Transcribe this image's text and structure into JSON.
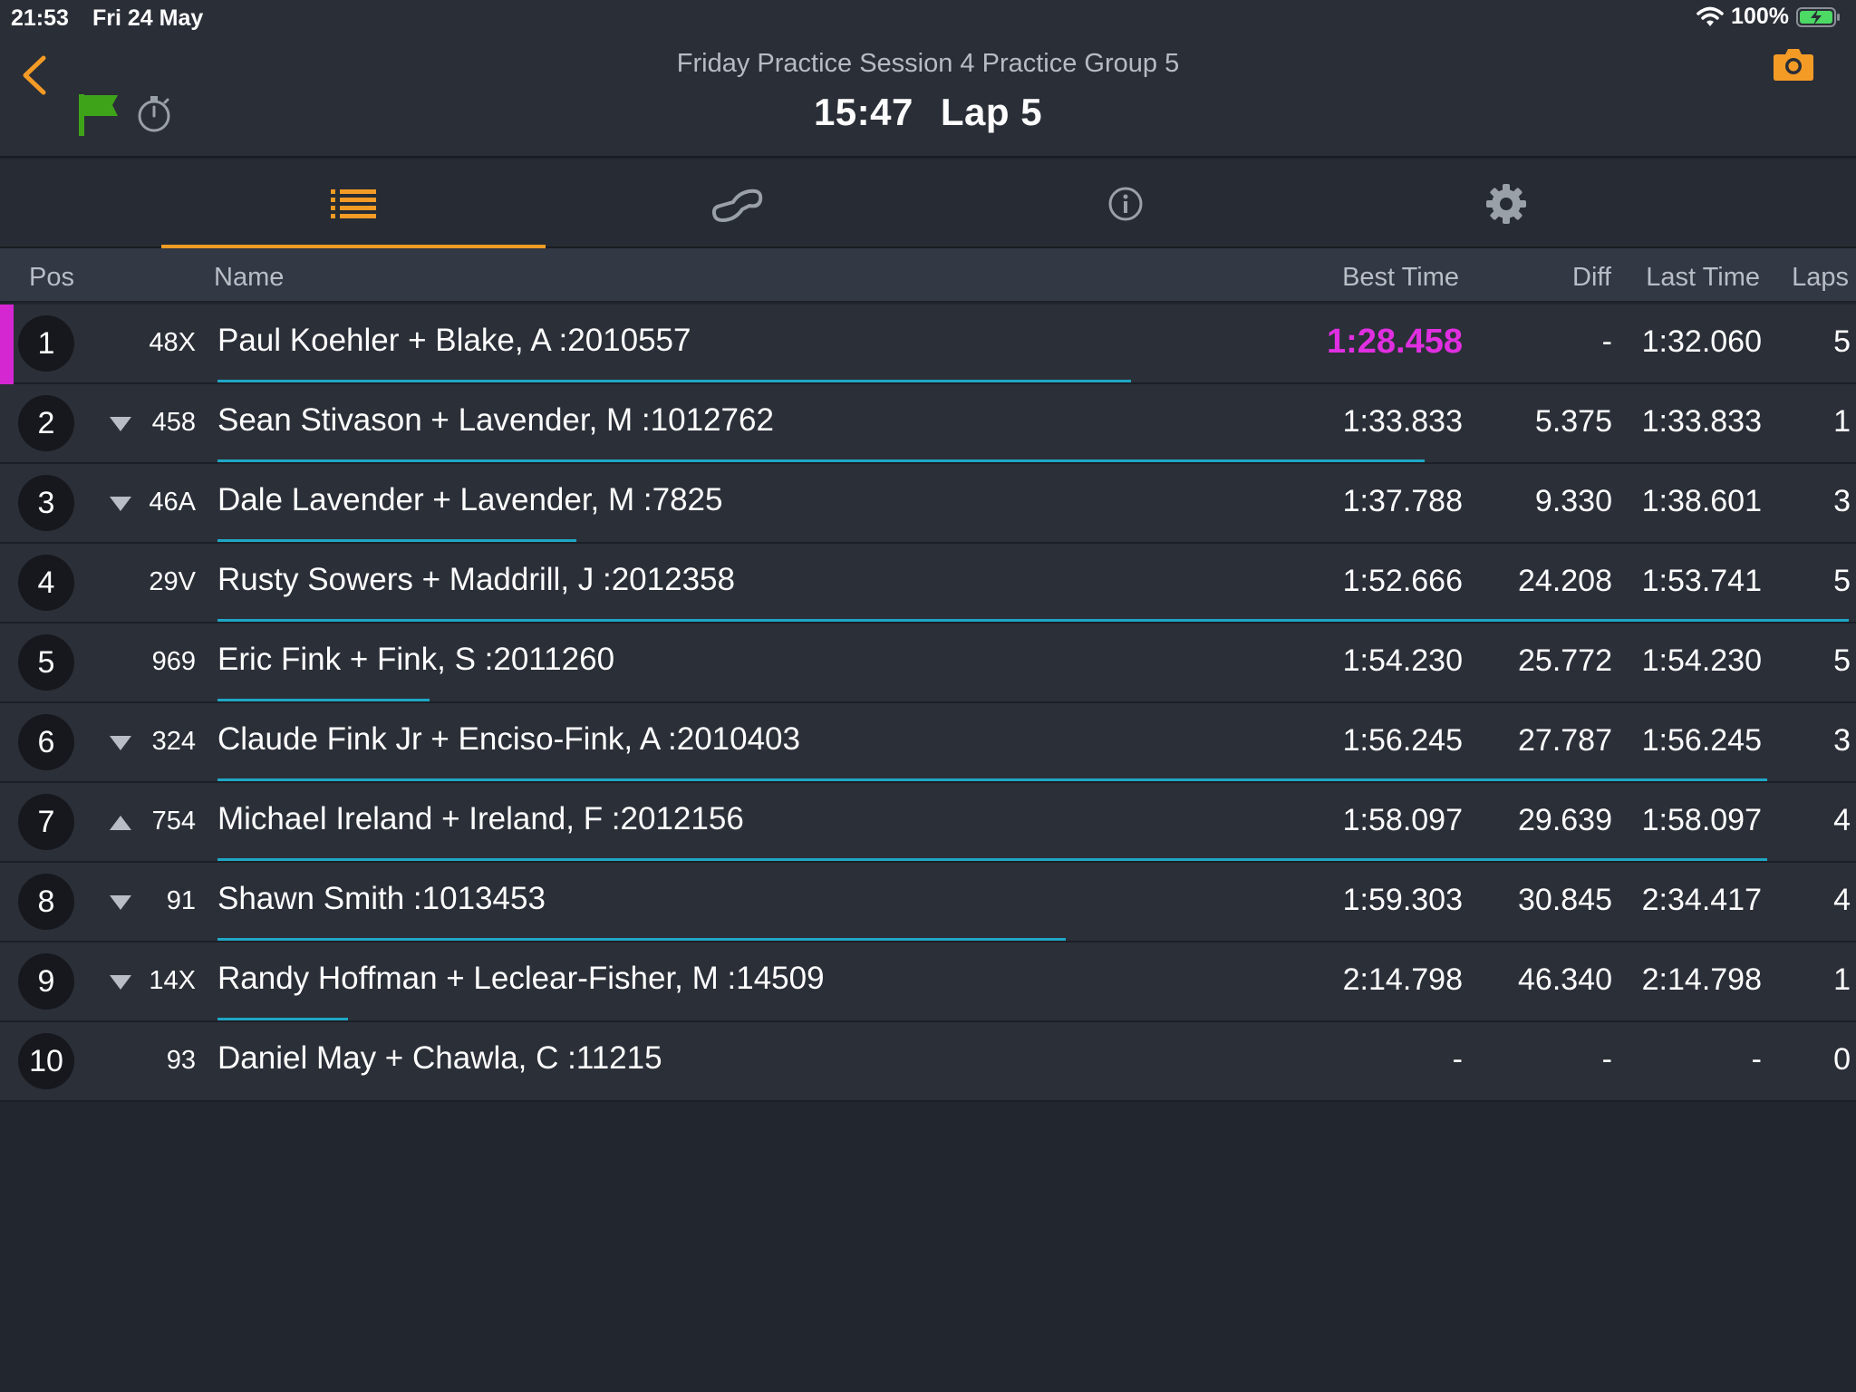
{
  "status_bar": {
    "time": "21:53",
    "date": "Fri 24 May",
    "battery": "100%"
  },
  "header": {
    "session_title": "Friday Practice Session 4 Practice Group 5",
    "clock": "15:47",
    "lap": "Lap 5"
  },
  "tabs": [
    {
      "icon": "list-icon",
      "active": true
    },
    {
      "icon": "track-map-icon",
      "active": false
    },
    {
      "icon": "info-icon",
      "active": false
    },
    {
      "icon": "gear-icon",
      "active": false
    }
  ],
  "columns": {
    "pos": "Pos",
    "name": "Name",
    "best_time": "Best Time",
    "diff": "Diff",
    "last_time": "Last Time",
    "laps": "Laps"
  },
  "colors": {
    "accent": "#f49b26",
    "best_lap": "#e02fe0",
    "progress": "#1fa7c6",
    "flag": "#3fa31a"
  },
  "rows": [
    {
      "pos": "1",
      "change": "",
      "car": "48X",
      "name": "Paul Koehler + Blake, A :2010557",
      "best": "1:28.458",
      "diff": "-",
      "last": "1:32.060",
      "laps": "5",
      "progress": 0.56,
      "leader": true
    },
    {
      "pos": "2",
      "change": "down",
      "car": "458",
      "name": "Sean Stivason + Lavender, M :1012762",
      "best": "1:33.833",
      "diff": "5.375",
      "last": "1:33.833",
      "laps": "1",
      "progress": 0.74
    },
    {
      "pos": "3",
      "change": "down",
      "car": "46A",
      "name": "Dale Lavender + Lavender, M :7825",
      "best": "1:37.788",
      "diff": "9.330",
      "last": "1:38.601",
      "laps": "3",
      "progress": 0.22
    },
    {
      "pos": "4",
      "change": "",
      "car": "29V",
      "name": "Rusty Sowers + Maddrill, J :2012358",
      "best": "1:52.666",
      "diff": "24.208",
      "last": "1:53.741",
      "laps": "5",
      "progress": 1.0
    },
    {
      "pos": "5",
      "change": "",
      "car": "969",
      "name": "Eric Fink + Fink, S :2011260",
      "best": "1:54.230",
      "diff": "25.772",
      "last": "1:54.230",
      "laps": "5",
      "progress": 0.13
    },
    {
      "pos": "6",
      "change": "down",
      "car": "324",
      "name": "Claude Fink Jr + Enciso-Fink, A :2010403",
      "best": "1:56.245",
      "diff": "27.787",
      "last": "1:56.245",
      "laps": "3",
      "progress": 0.95
    },
    {
      "pos": "7",
      "change": "up",
      "car": "754",
      "name": "Michael Ireland + Ireland, F :2012156",
      "best": "1:58.097",
      "diff": "29.639",
      "last": "1:58.097",
      "laps": "4",
      "progress": 0.95
    },
    {
      "pos": "8",
      "change": "down",
      "car": "91",
      "name": "Shawn Smith :1013453",
      "best": "1:59.303",
      "diff": "30.845",
      "last": "2:34.417",
      "laps": "4",
      "progress": 0.52
    },
    {
      "pos": "9",
      "change": "down",
      "car": "14X",
      "name": "Randy Hoffman + Leclear-Fisher, M :14509",
      "best": "2:14.798",
      "diff": "46.340",
      "last": "2:14.798",
      "laps": "1",
      "progress": 0.08
    },
    {
      "pos": "10",
      "change": "",
      "car": "93",
      "name": "Daniel May + Chawla, C :11215",
      "best": "-",
      "diff": "-",
      "last": "-",
      "laps": "0",
      "progress": 0.0
    }
  ]
}
